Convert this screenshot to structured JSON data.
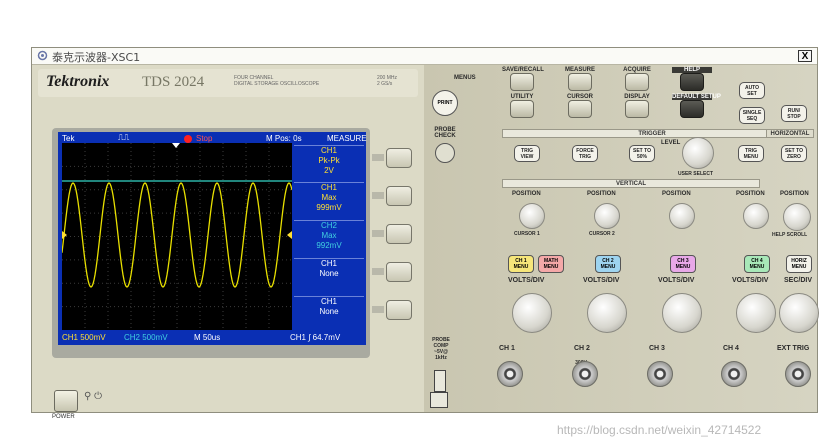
{
  "window": {
    "title": "泰克示波器-XSC1",
    "close_label": "X"
  },
  "header": {
    "brand": "Tektronix",
    "model": "TDS 2024",
    "description_line1": "FOUR CHANNEL",
    "description_line2": "DIGITAL STORAGE OSCILLOSCOPE",
    "spec_line1": "200 MHz",
    "spec_line2": "2 GS/s"
  },
  "screen": {
    "brand": "Tek",
    "trigger_symbol": "⎍⎍",
    "run_state": "Stop",
    "mpos": "M Pos: 0s",
    "menu_title": "MEASURE",
    "menu_items": [
      {
        "line1": "CH1",
        "line2": "Pk-Pk",
        "line3": "2V",
        "color": "#ffe033"
      },
      {
        "line1": "CH1",
        "line2": "Max",
        "line3": "999mV",
        "color": "#ffe033"
      },
      {
        "line1": "CH2",
        "line2": "Max",
        "line3": "992mV",
        "color": "#40d0e0"
      },
      {
        "line1": "CH1",
        "line2": "None",
        "line3": "",
        "color": "#ffffff"
      },
      {
        "line1": "CH1",
        "line2": "None",
        "line3": "",
        "color": "#ffffff"
      }
    ],
    "footer": {
      "ch1": "CH1 500mV",
      "ch2": "CH2 500mV",
      "timebase": "M 50us",
      "trigger": "CH1 ∫ 64.7mV"
    },
    "ch1_marker": "1",
    "ch2_marker": "2",
    "ch1_color": "#e8e000",
    "ch2_color": "#35d6c8"
  },
  "power_label": "POWER",
  "controls": {
    "menus_label": "MENUS",
    "print_label": "PRINT",
    "probe_check_label": "PROBE CHECK",
    "top_buttons": [
      {
        "label": "SAVE/RECALL"
      },
      {
        "label": "MEASURE"
      },
      {
        "label": "ACQUIRE"
      },
      {
        "label": "HELP"
      },
      {
        "label": "UTILITY"
      },
      {
        "label": "CURSOR"
      },
      {
        "label": "DISPLAY"
      },
      {
        "label": "DEFAULT SETUP"
      }
    ],
    "autoset_label": "AUTO SET",
    "single_seq_label": "SINGLE SEQ",
    "run_stop_label": "RUN/ STOP",
    "trigger_section": "TRIGGER",
    "trig_view_label": "TRIG VIEW",
    "force_trig_label": "FORCE TRIG",
    "set_to_50_label": "SET TO 50%",
    "level_label": "LEVEL",
    "user_select_label": "USER SELECT",
    "trig_menu_label": "TRIG MENU",
    "horizontal_section": "HORIZONTAL",
    "set_to_zero_label": "SET TO ZERO",
    "vertical_section": "VERTICAL",
    "position_label": "POSITION",
    "cursor1_label": "CURSOR 1",
    "cursor2_label": "CURSOR 2",
    "help_scroll_label": "HELP SCROLL",
    "channel_menus": [
      {
        "label": "CH 1 MENU",
        "color": "#f6e67a"
      },
      {
        "label": "MATH MENU",
        "color": "#f4a8a8"
      },
      {
        "label": "CH 2 MENU",
        "color": "#9ed4f0"
      },
      {
        "label": "CH 3 MENU",
        "color": "#e8a8e8"
      },
      {
        "label": "CH 4 MENU",
        "color": "#a8e8b8"
      },
      {
        "label": "HORIZ MENU",
        "color": "#f3f2ea"
      }
    ],
    "volts_div_label": "VOLTS/DIV",
    "sec_div_label": "SEC/DIV",
    "inputs": [
      "CH 1",
      "CH 2",
      "CH 3",
      "CH 4",
      "EXT TRIG"
    ],
    "probe_comp_label": "PROBE COMP ~5V@ 1kHz",
    "cat_label": "300V CAT II"
  },
  "watermark": "https://blog.csdn.net/weixin_42714522"
}
